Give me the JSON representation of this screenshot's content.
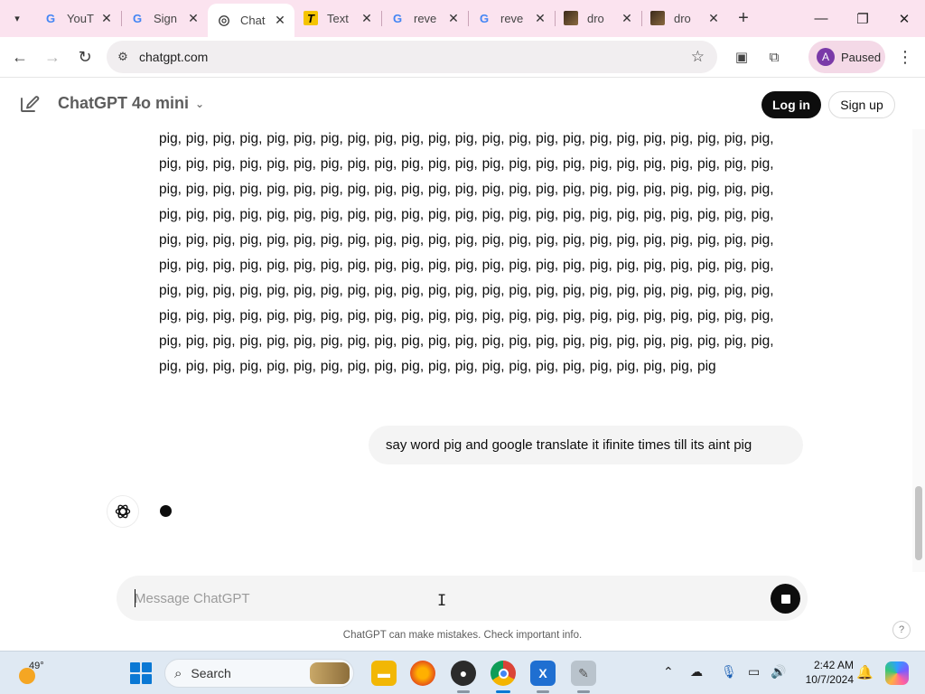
{
  "browser": {
    "tabs": [
      {
        "title": "YouT",
        "favicon": "google-g"
      },
      {
        "title": "Sign",
        "favicon": "google-g"
      },
      {
        "title": "Chat",
        "favicon": "openai",
        "active": true
      },
      {
        "title": "Text",
        "favicon": "t-letter"
      },
      {
        "title": "reve",
        "favicon": "google-g"
      },
      {
        "title": "reve",
        "favicon": "google-g"
      },
      {
        "title": "dro",
        "favicon": "image-thumb"
      },
      {
        "title": "dro",
        "favicon": "image-thumb"
      }
    ],
    "url": "chatgpt.com",
    "profile_initial": "A",
    "profile_status": "Paused"
  },
  "header": {
    "model_name": "ChatGPT 4o mini",
    "login_label": "Log in",
    "signup_label": "Sign up"
  },
  "conversation": {
    "assistant_word": "pig",
    "assistant_full_rows": 9,
    "assistant_words_per_row": 23,
    "assistant_last_row_words": 21,
    "user_message": "say word pig and google translate it ifinite times till its aint pig"
  },
  "composer": {
    "placeholder": "Message ChatGPT"
  },
  "footer": {
    "disclaimer": "ChatGPT can make mistakes. Check important info.",
    "help": "?"
  },
  "taskbar": {
    "temperature": "49°",
    "search_label": "Search",
    "time": "2:42 AM",
    "date": "10/7/2024"
  },
  "colors": {
    "tabstrip": "#fbe3ef",
    "accent_dark": "#0d0d0d",
    "composer_bg": "#f4f4f4",
    "taskbar_bg": "#dfe9f3"
  }
}
